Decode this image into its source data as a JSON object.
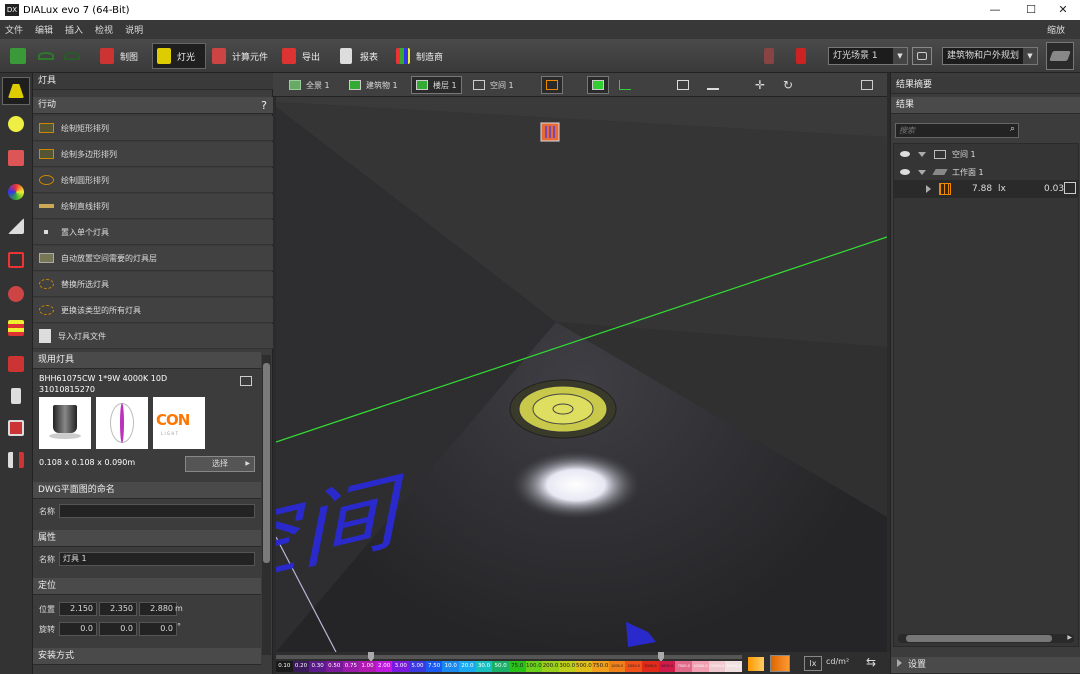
{
  "window": {
    "title": "DIALux evo 7  (64-Bit)",
    "logo": "DX",
    "minimize": "—",
    "maximize": "☐",
    "close": "✕"
  },
  "menu": {
    "items": [
      "文件",
      "编辑",
      "插入",
      "检视",
      "说明"
    ],
    "zoom": "缩放"
  },
  "toolbar": {
    "draw": "制图",
    "light": "灯光",
    "calc": "计算元件",
    "export": "导出",
    "report": "报表",
    "manufacturer": "制造商",
    "scene_select": "灯光场景 1",
    "project_select": "建筑物和户外规划"
  },
  "left_panel": {
    "header": "灯具",
    "subheader": "行动",
    "help": "?",
    "actions": [
      "绘制矩形排列",
      "绘制多边形排列",
      "绘制圆形排列",
      "绘制直线排列",
      "置入单个灯具",
      "自动放置空间需要的灯具层",
      "替换所选灯具",
      "更换该类型的所有灯具",
      "导入灯具文件"
    ],
    "luminaire": {
      "section": "现用灯具",
      "name": "BHH61075CW 1*9W 4000K 10D",
      "code": "31010815270",
      "dims": "0.108 x 0.108 x 0.090m",
      "select": "选择",
      "logo_text": "CON",
      "logo_sub": "L I G H T"
    },
    "dwg": {
      "section": "DWG平面图的命名",
      "name_label": "名称",
      "name_value": ""
    },
    "attr": {
      "section": "属性",
      "name_label": "名称",
      "name_value": "灯具 1"
    },
    "position": {
      "section": "定位",
      "pos_label": "位置",
      "pos": [
        "2.150",
        "2.350",
        "2.880"
      ],
      "unit": "m",
      "rot_label": "旋转",
      "rot": [
        "0.0",
        "0.0",
        "0.0"
      ],
      "rot_unit": "°"
    },
    "mount": {
      "section": "安装方式"
    }
  },
  "view_tabs": {
    "all": "全景 1",
    "building": "建筑物 1",
    "floor": "楼层 1",
    "space": "空间 1"
  },
  "viewport": {
    "floor_text": "空间"
  },
  "colorbar": {
    "labels": [
      "0.10",
      "0.20",
      "0.30",
      "0.50",
      "0.75",
      "1.00",
      "2.00",
      "3.00",
      "5.00",
      "7.50",
      "10.0",
      "20.0",
      "30.0",
      "50.0",
      "75.0",
      "100.0",
      "200.0",
      "300.0",
      "500.0",
      "750.0",
      "1000.0",
      "2000.0",
      "3000.0",
      "5000.0",
      "7500.0",
      "10000.0",
      "20000.0",
      "30000.0"
    ],
    "colors": [
      "#1a1a1a",
      "#3a1a5a",
      "#5a1a8a",
      "#7a1a9a",
      "#9a1aaa",
      "#b01ab0",
      "#c01ae0",
      "#7a1ae0",
      "#3a3ae0",
      "#1a5af0",
      "#1a8af0",
      "#1aaaf0",
      "#1ac0c0",
      "#1ab06a",
      "#2ac01a",
      "#6ad01a",
      "#9ad01a",
      "#c0d01a",
      "#e0c01a",
      "#f0a01a",
      "#f0801a",
      "#f0501a",
      "#e02a1a",
      "#d01a4a",
      "#e06a8a",
      "#f0a0b0",
      "#f0c8d0",
      "#f0e0e0"
    ],
    "unit_lx": "lx",
    "unit_cd": "cd/m²"
  },
  "right_panel": {
    "header": "结果摘要",
    "subheader": "结果",
    "search_placeholder": "搜索",
    "tree": {
      "space": "空间 1",
      "workplane": "工作面 1",
      "value": "7.88",
      "unit": "lx",
      "ratio": "0.03"
    },
    "settings": "设置"
  }
}
